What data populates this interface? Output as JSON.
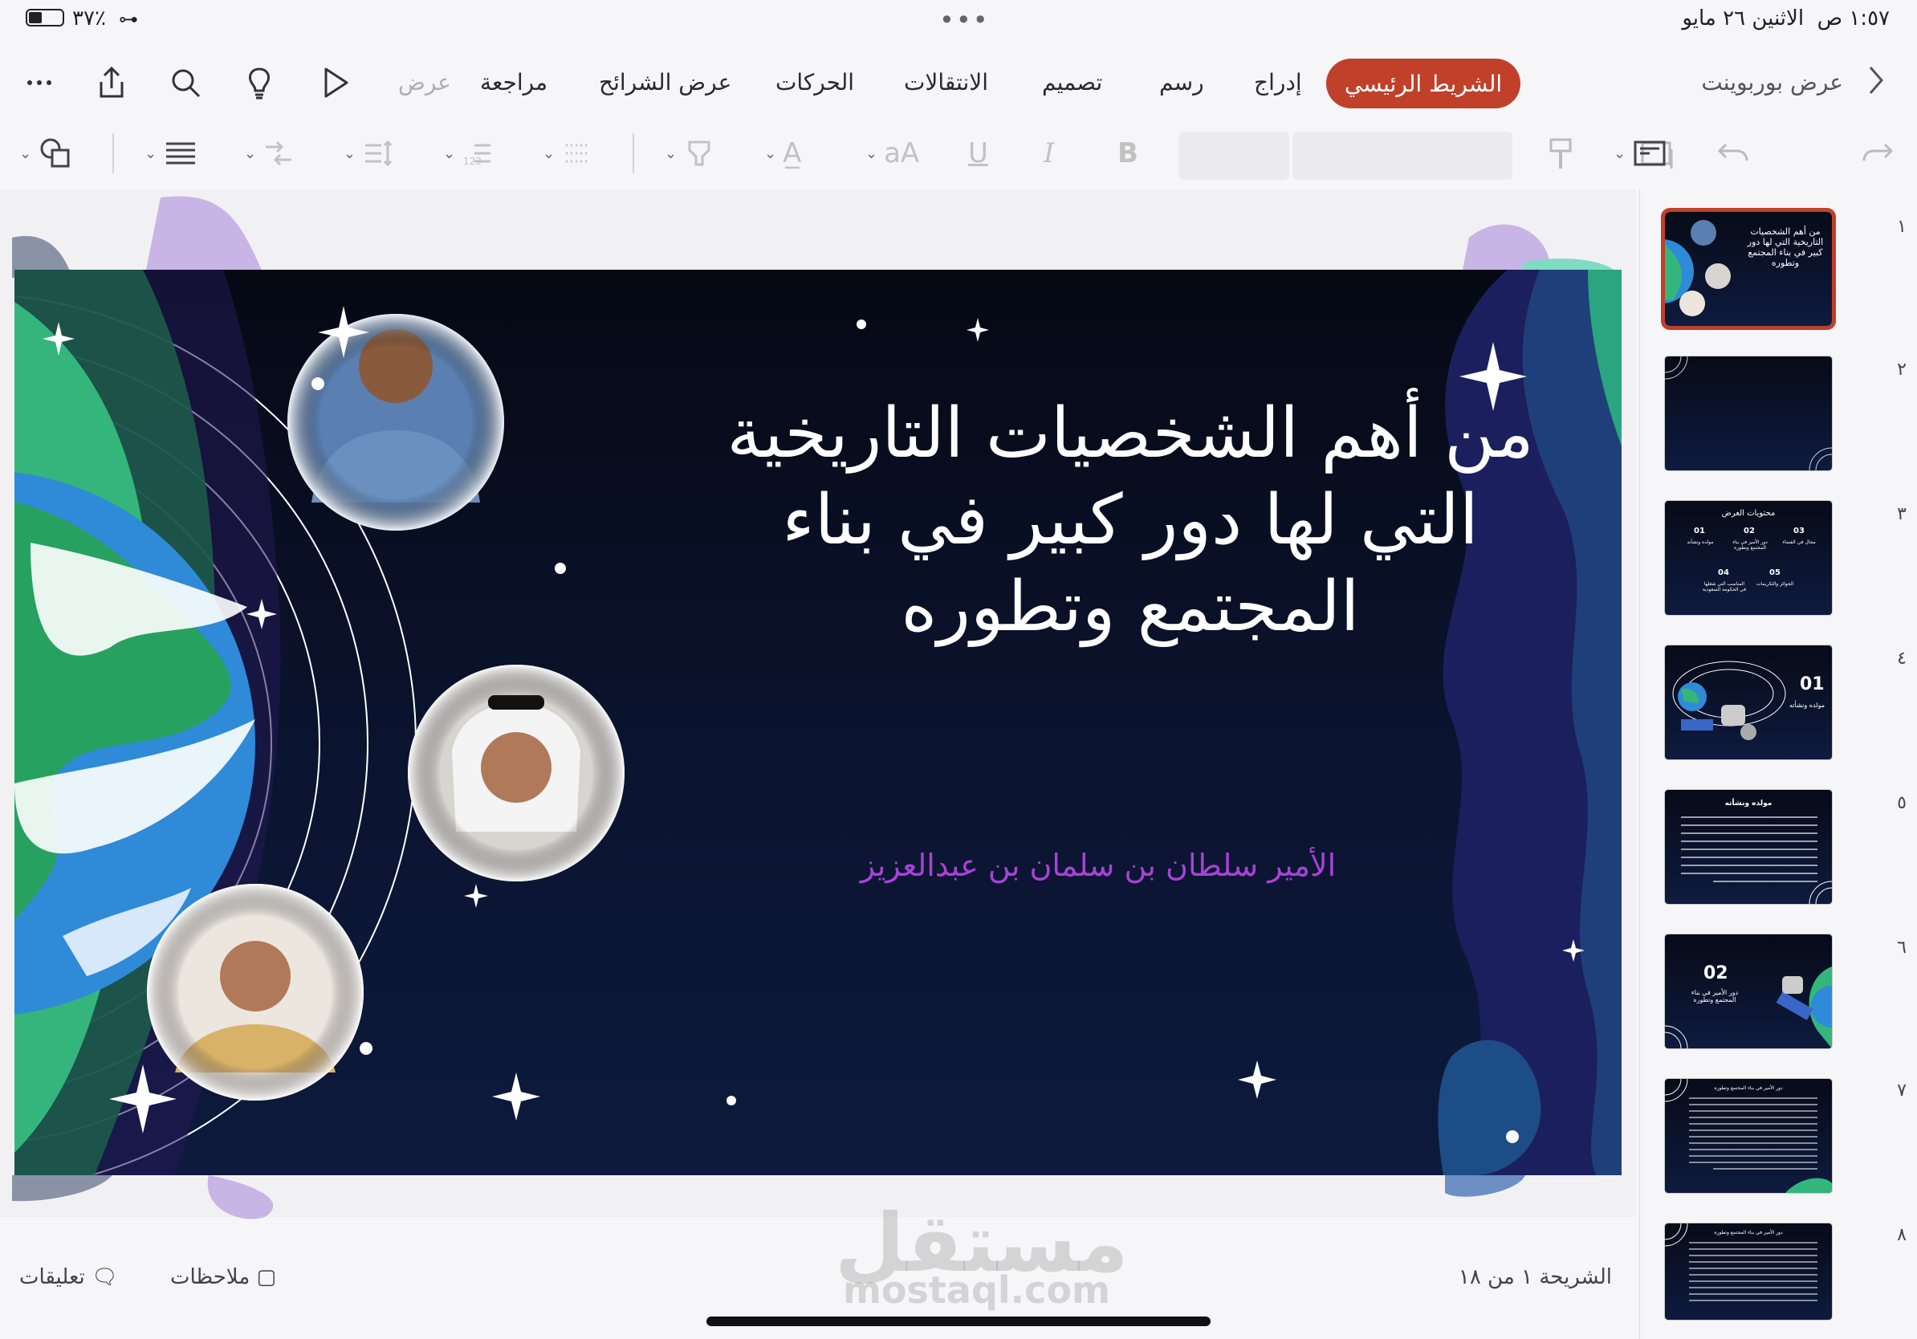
{
  "status": {
    "time": "١:٥٧ ص",
    "date": "الاثنين ٢٦ مايو",
    "battery": "٣٧٪"
  },
  "app": {
    "title": "عرض بوربوينت"
  },
  "tabs": [
    {
      "id": "home",
      "label": "الشريط الرئيسي",
      "selected": true
    },
    {
      "id": "insert",
      "label": "إدراج"
    },
    {
      "id": "draw",
      "label": "رسم"
    },
    {
      "id": "design",
      "label": "تصميم"
    },
    {
      "id": "transitions",
      "label": "الانتقالات"
    },
    {
      "id": "animations",
      "label": "الحركات"
    },
    {
      "id": "slideshow",
      "label": "عرض الشرائح"
    },
    {
      "id": "review",
      "label": "مراجعة"
    },
    {
      "id": "view",
      "label": "عرض"
    }
  ],
  "slide": {
    "title": "من أهم الشخصيات التاريخية التي لها دور كبير في بناء المجتمع وتطوره",
    "subtitle": "الأمير سلطان بن سلمان بن عبدالعزيز"
  },
  "footer": {
    "slide_counter": "الشريحة ١ من ١٨",
    "notes": "ملاحظات",
    "comments": "تعليقات"
  },
  "watermark": {
    "ar": "مستقل",
    "en": "mostaql.com"
  },
  "thumbnails": [
    {
      "num": "١",
      "title": "من أهم الشخصيات التاريخية التي لها دور كبير في بناء المجتمع وتطوره"
    },
    {
      "num": "٢"
    },
    {
      "num": "٣",
      "title": "محتويات العرض",
      "items": [
        "01",
        "02",
        "03",
        "04",
        "05"
      ],
      "captions": [
        "مولده ونشأته",
        "دور الأمير في بناء المجتمع وتطوره",
        "مجال في الفضاء",
        "المناصب التي شغلها في الحكومة السعودية",
        "الجوائز والتكريمات"
      ]
    },
    {
      "num": "٤",
      "big": "01",
      "caption": "مولده ونشأته"
    },
    {
      "num": "٥",
      "title": "مولده ونشأته"
    },
    {
      "num": "٦",
      "big": "02",
      "caption": "دور الأمير في بناء المجتمع وتطوره"
    },
    {
      "num": "٧",
      "title": "دور الأمير في بناء المجتمع وتطوره"
    },
    {
      "num": "٨",
      "title": "دور الأمير في بناء المجتمع وتطوره"
    }
  ],
  "colors": {
    "accent": "#c0402a",
    "slide_bg": "#0b1430",
    "subtitle": "#a842d6"
  }
}
